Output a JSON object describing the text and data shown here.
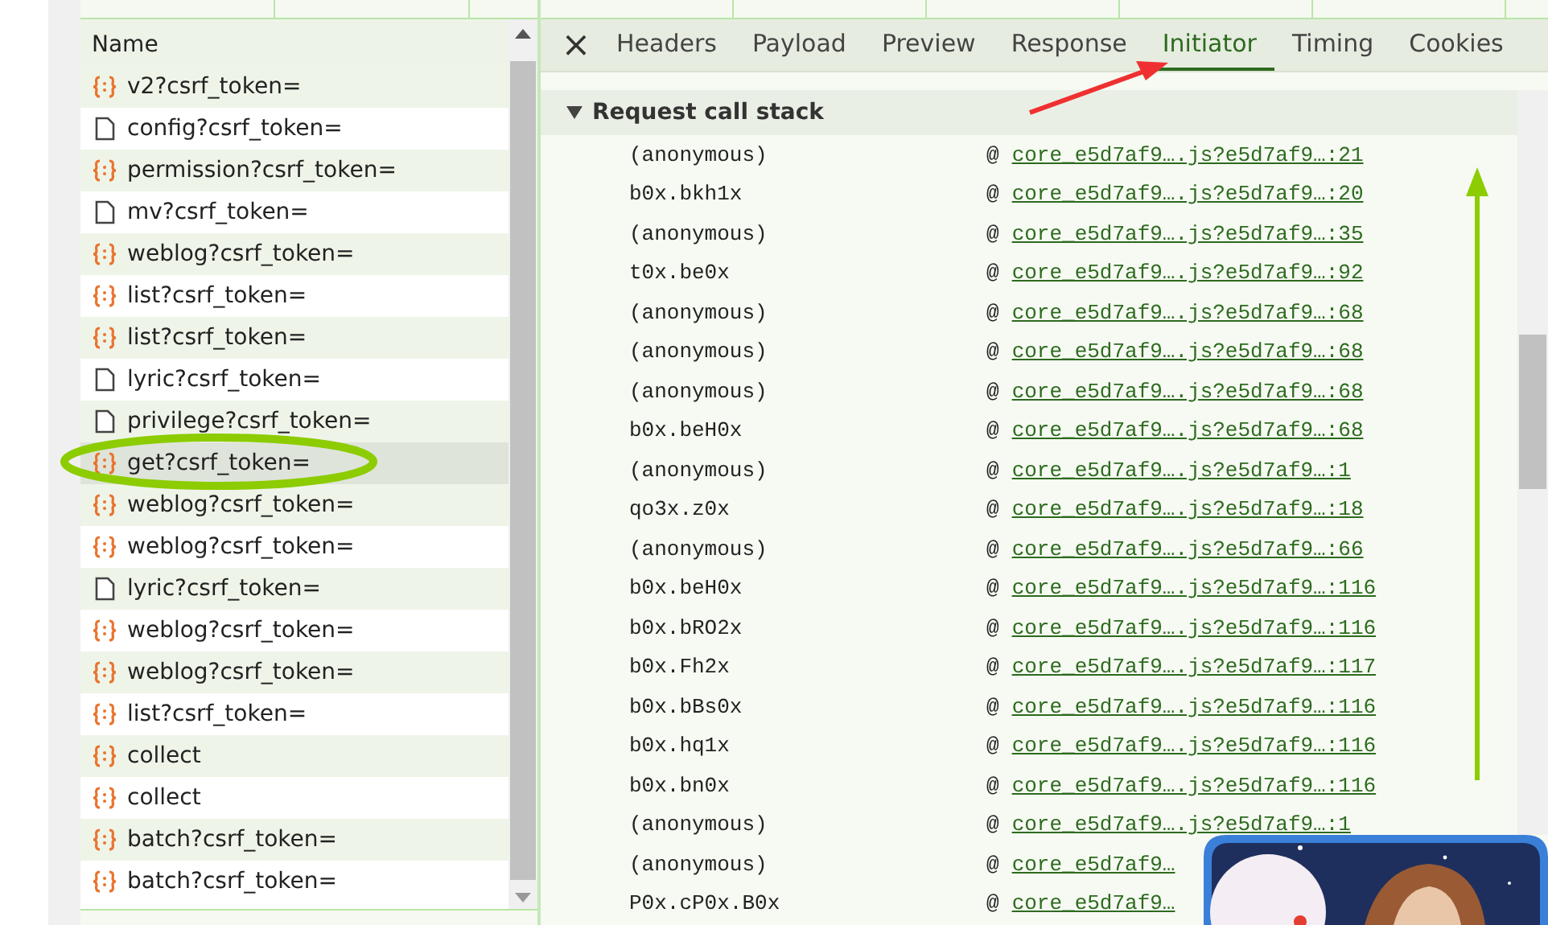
{
  "request_list": {
    "header": "Name",
    "rows": [
      {
        "name": "v2?csrf_token=",
        "kind": "script",
        "selected": false
      },
      {
        "name": "config?csrf_token=",
        "kind": "document",
        "selected": false
      },
      {
        "name": "permission?csrf_token=",
        "kind": "script",
        "selected": false
      },
      {
        "name": "mv?csrf_token=",
        "kind": "document",
        "selected": false
      },
      {
        "name": "weblog?csrf_token=",
        "kind": "script",
        "selected": false
      },
      {
        "name": "list?csrf_token=",
        "kind": "script",
        "selected": false
      },
      {
        "name": "list?csrf_token=",
        "kind": "script",
        "selected": false
      },
      {
        "name": "lyric?csrf_token=",
        "kind": "document",
        "selected": false
      },
      {
        "name": "privilege?csrf_token=",
        "kind": "document",
        "selected": false
      },
      {
        "name": "get?csrf_token=",
        "kind": "script",
        "selected": true
      },
      {
        "name": "weblog?csrf_token=",
        "kind": "script",
        "selected": false
      },
      {
        "name": "weblog?csrf_token=",
        "kind": "script",
        "selected": false
      },
      {
        "name": "lyric?csrf_token=",
        "kind": "document",
        "selected": false
      },
      {
        "name": "weblog?csrf_token=",
        "kind": "script",
        "selected": false
      },
      {
        "name": "weblog?csrf_token=",
        "kind": "script",
        "selected": false
      },
      {
        "name": "list?csrf_token=",
        "kind": "script",
        "selected": false
      },
      {
        "name": "collect",
        "kind": "script",
        "selected": false
      },
      {
        "name": "collect",
        "kind": "script",
        "selected": false
      },
      {
        "name": "batch?csrf_token=",
        "kind": "script",
        "selected": false
      },
      {
        "name": "batch?csrf_token=",
        "kind": "script",
        "selected": false
      }
    ]
  },
  "detail": {
    "close": "×",
    "tabs": [
      {
        "label": "Headers",
        "selected": false
      },
      {
        "label": "Payload",
        "selected": false
      },
      {
        "label": "Preview",
        "selected": false
      },
      {
        "label": "Response",
        "selected": false
      },
      {
        "label": "Initiator",
        "selected": true
      },
      {
        "label": "Timing",
        "selected": false
      },
      {
        "label": "Cookies",
        "selected": false
      }
    ],
    "section": {
      "title": "Request call stack",
      "expanded": true,
      "frames": [
        {
          "function": "(anonymous)",
          "at": "@",
          "location": "core_e5d7af9….js?e5d7af9…:21"
        },
        {
          "function": "b0x.bkh1x",
          "at": "@",
          "location": "core_e5d7af9….js?e5d7af9…:20"
        },
        {
          "function": "(anonymous)",
          "at": "@",
          "location": "core_e5d7af9….js?e5d7af9…:35"
        },
        {
          "function": "t0x.be0x",
          "at": "@",
          "location": "core_e5d7af9….js?e5d7af9…:92"
        },
        {
          "function": "(anonymous)",
          "at": "@",
          "location": "core_e5d7af9….js?e5d7af9…:68"
        },
        {
          "function": "(anonymous)",
          "at": "@",
          "location": "core_e5d7af9….js?e5d7af9…:68"
        },
        {
          "function": "(anonymous)",
          "at": "@",
          "location": "core_e5d7af9….js?e5d7af9…:68"
        },
        {
          "function": "b0x.beH0x",
          "at": "@",
          "location": "core_e5d7af9….js?e5d7af9…:68"
        },
        {
          "function": "(anonymous)",
          "at": "@",
          "location": "core_e5d7af9….js?e5d7af9…:1"
        },
        {
          "function": "qo3x.z0x",
          "at": "@",
          "location": "core_e5d7af9….js?e5d7af9…:18"
        },
        {
          "function": "(anonymous)",
          "at": "@",
          "location": "core_e5d7af9….js?e5d7af9…:66"
        },
        {
          "function": "b0x.beH0x",
          "at": "@",
          "location": "core_e5d7af9….js?e5d7af9…:116"
        },
        {
          "function": "b0x.bRO2x",
          "at": "@",
          "location": "core_e5d7af9….js?e5d7af9…:116"
        },
        {
          "function": "b0x.Fh2x",
          "at": "@",
          "location": "core_e5d7af9….js?e5d7af9…:117"
        },
        {
          "function": "b0x.bBs0x",
          "at": "@",
          "location": "core_e5d7af9….js?e5d7af9…:116"
        },
        {
          "function": "b0x.hq1x",
          "at": "@",
          "location": "core_e5d7af9….js?e5d7af9…:116"
        },
        {
          "function": "b0x.bn0x",
          "at": "@",
          "location": "core_e5d7af9….js?e5d7af9…:116"
        },
        {
          "function": "(anonymous)",
          "at": "@",
          "location": "core_e5d7af9….js?e5d7af9…:1"
        },
        {
          "function": "(anonymous)",
          "at": "@",
          "location": "core_e5d7af9…"
        },
        {
          "function": "P0x.cP0x.B0x",
          "at": "@",
          "location": "core_e5d7af9…"
        }
      ]
    }
  }
}
